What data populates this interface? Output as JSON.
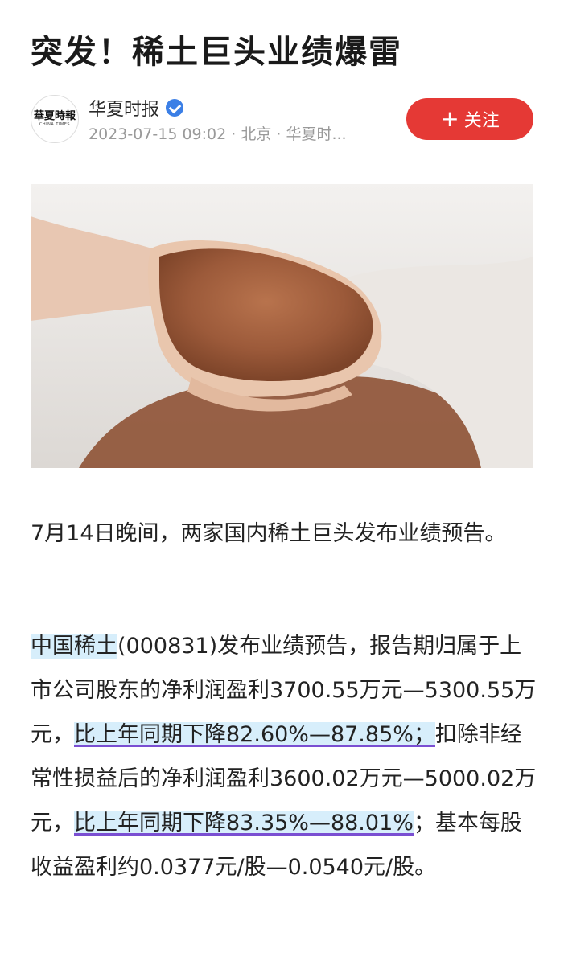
{
  "article": {
    "title": "突发！稀土巨头业绩爆雷"
  },
  "author": {
    "logo_text": "華夏時報",
    "logo_subtext": "CHINA TIMES",
    "name": "华夏时报",
    "meta": "2023-07-15 09:02 · 北京 · 华夏时..."
  },
  "follow_button": {
    "icon": "plus-icon",
    "plus": "+",
    "label": "关注"
  },
  "image": {
    "icon": "rare-earth-photo"
  },
  "body": {
    "p1": "7月14日晚间，两家国内稀土巨头发布业绩预告。",
    "p2": {
      "company": "中国稀土",
      "s1": "(000831)发布业绩预告，报告期归属于上市公司股东的净利润盈利3700.55万元—5300.55万元，",
      "hl1": "比上年同期下降82.60%—87.85%；",
      "s2": "扣除非经常性损益后的净利润盈利3600.02万元—5000.02万元，",
      "hl2": "比上年同期下降83.35%—88.01%",
      "s3": "；基本每股收益盈利约0.0377元/股—0.0540元/股。"
    }
  },
  "colors": {
    "accent_red": "#e53935",
    "highlight_blue": "#d7eefb",
    "underline_purple": "#7a4fd2",
    "verified_blue": "#3b7fe6"
  }
}
